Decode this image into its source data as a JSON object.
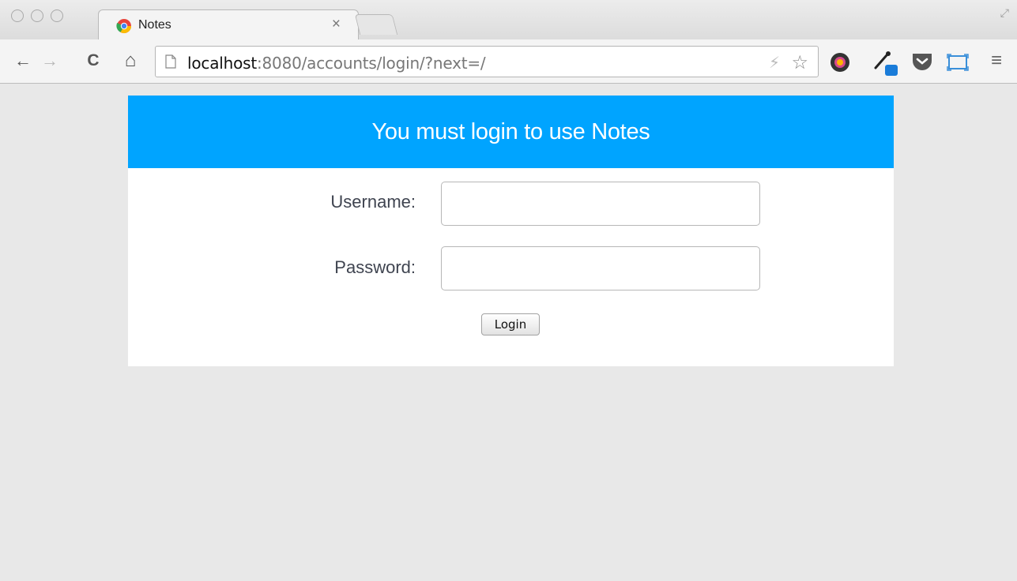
{
  "browser": {
    "tab": {
      "title": "Notes",
      "close_label": "×"
    },
    "url": {
      "host": "localhost",
      "rest": ":8080/accounts/login/?next=/"
    },
    "nav": {
      "back_glyph": "←",
      "forward_glyph": "→",
      "reload_glyph": "C",
      "home_glyph": "⌂"
    },
    "icons": {
      "favicon": "chrome-logo-icon",
      "bookmark": "star-icon",
      "menu": "hamburger-menu-icon"
    },
    "colors": {
      "accent": "#00a4ff",
      "page_background": "#e8e8e8"
    }
  },
  "login": {
    "header": "You must login to use Notes",
    "username_label": "Username:",
    "password_label": "Password:",
    "username_value": "",
    "password_value": "",
    "submit_label": "Login"
  }
}
